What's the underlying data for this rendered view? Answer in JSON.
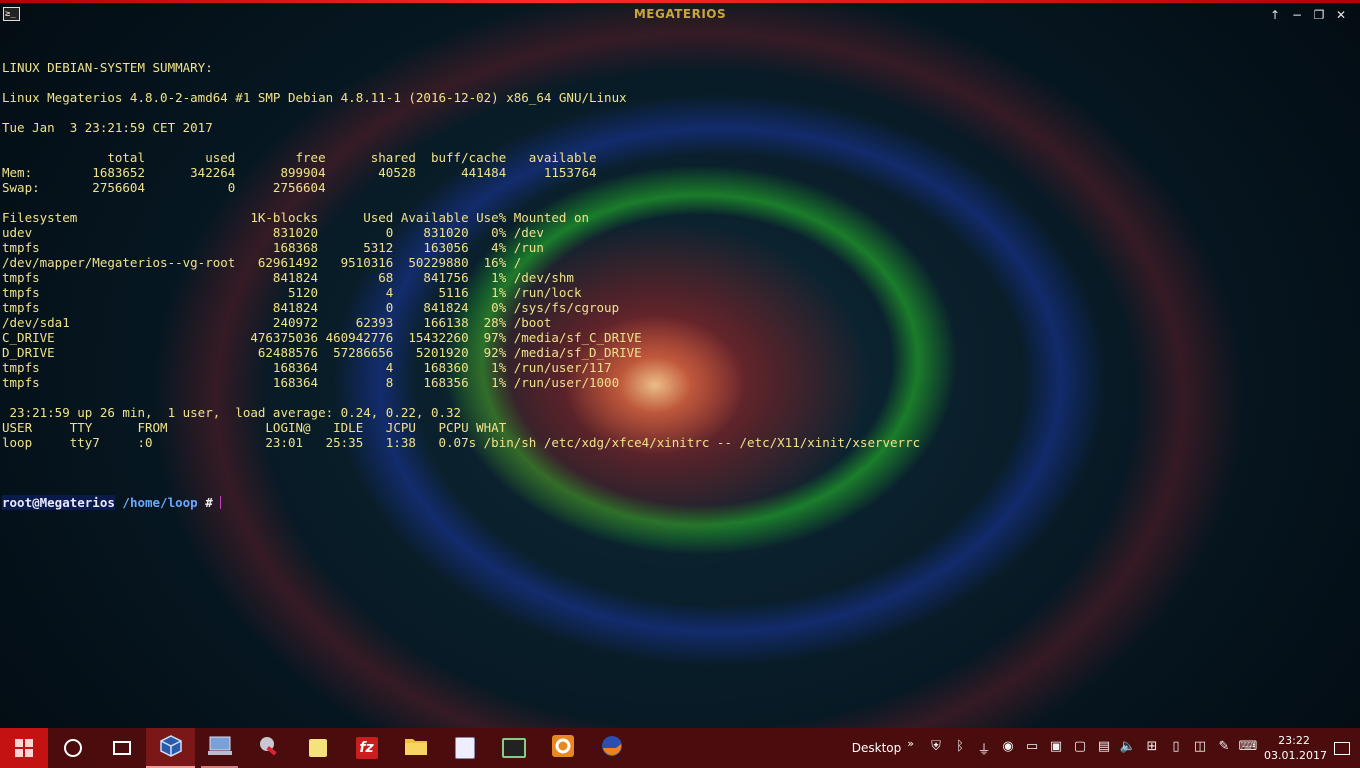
{
  "window": {
    "title": "MEGATERIOS",
    "app_icon_glyph": "≥_",
    "controls": [
      "↑",
      "−",
      "❐",
      "✕"
    ]
  },
  "terminal": {
    "lines": [
      "LINUX DEBIAN-SYSTEM SUMMARY:",
      "",
      "Linux Megaterios 4.8.0-2-amd64 #1 SMP Debian 4.8.11-1 (2016-12-02) x86_64 GNU/Linux",
      "",
      "Tue Jan  3 23:21:59 CET 2017",
      "",
      "              total        used        free      shared  buff/cache   available",
      "Mem:        1683652      342264      899904       40528      441484     1153764",
      "Swap:       2756604           0     2756604",
      "",
      "Filesystem                       1K-blocks      Used Available Use% Mounted on",
      "udev                                831020         0    831020   0% /dev",
      "tmpfs                               168368      5312    163056   4% /run",
      "/dev/mapper/Megaterios--vg-root   62961492   9510316  50229880  16% /",
      "tmpfs                               841824        68    841756   1% /dev/shm",
      "tmpfs                                 5120         4      5116   1% /run/lock",
      "tmpfs                               841824         0    841824   0% /sys/fs/cgroup",
      "/dev/sda1                           240972     62393    166138  28% /boot",
      "C_DRIVE                          476375036 460942776  15432260  97% /media/sf_C_DRIVE",
      "D_DRIVE                           62488576  57286656   5201920  92% /media/sf_D_DRIVE",
      "tmpfs                               168364         4    168360   1% /run/user/117",
      "tmpfs                               168364         8    168356   1% /run/user/1000",
      "",
      " 23:21:59 up 26 min,  1 user,  load average: 0.24, 0.22, 0.32",
      "USER     TTY      FROM             LOGIN@   IDLE   JCPU   PCPU WHAT",
      "loop     tty7     :0               23:01   25:35   1:38   0.07s /bin/sh /etc/xdg/xfce4/xinitrc -- /etc/X11/xinit/xserverrc",
      ""
    ],
    "prompt": {
      "user_host": "root@Megaterios",
      "path": "/home/loop",
      "symbol": "#"
    }
  },
  "taskbar": {
    "items": [
      {
        "name": "taskbar-cortana-search",
        "icon": "search-ring-icon"
      },
      {
        "name": "taskbar-task-view",
        "icon": "task-view-icon"
      },
      {
        "name": "taskbar-virtualbox",
        "icon": "virtualbox-icon",
        "state": "active"
      },
      {
        "name": "taskbar-virtual-machine",
        "icon": "computer-icon",
        "state": "open"
      },
      {
        "name": "taskbar-tool-app",
        "icon": "tools-icon"
      },
      {
        "name": "taskbar-sticky-notes",
        "icon": "sticky-note-icon"
      },
      {
        "name": "taskbar-filezilla",
        "icon": "filezilla-icon"
      },
      {
        "name": "taskbar-file-explorer",
        "icon": "folder-icon"
      },
      {
        "name": "taskbar-photos",
        "icon": "picture-icon"
      },
      {
        "name": "taskbar-terminal-app",
        "icon": "terminal-icon"
      },
      {
        "name": "taskbar-settings-app",
        "icon": "gear-icon"
      },
      {
        "name": "taskbar-firefox",
        "icon": "firefox-icon"
      }
    ],
    "desktop_label": "Desktop",
    "chevron": "»",
    "tray_icons": [
      "shield-icon",
      "bluetooth-icon",
      "usb-icon",
      "record-icon",
      "monitor-icon",
      "display-icon",
      "screen-icon",
      "security-icon",
      "volume-icon",
      "network-icon",
      "battery-icon",
      "wifi-icon",
      "pen-icon",
      "keyboard-icon"
    ],
    "clock": {
      "time": "23:22",
      "date": "03.01.2017"
    }
  },
  "colors": {
    "terminal_text": "#f0e28a",
    "taskbar_bg": "#4a0c0c",
    "start_bg": "#c41212",
    "title_text": "#c8a63a"
  }
}
